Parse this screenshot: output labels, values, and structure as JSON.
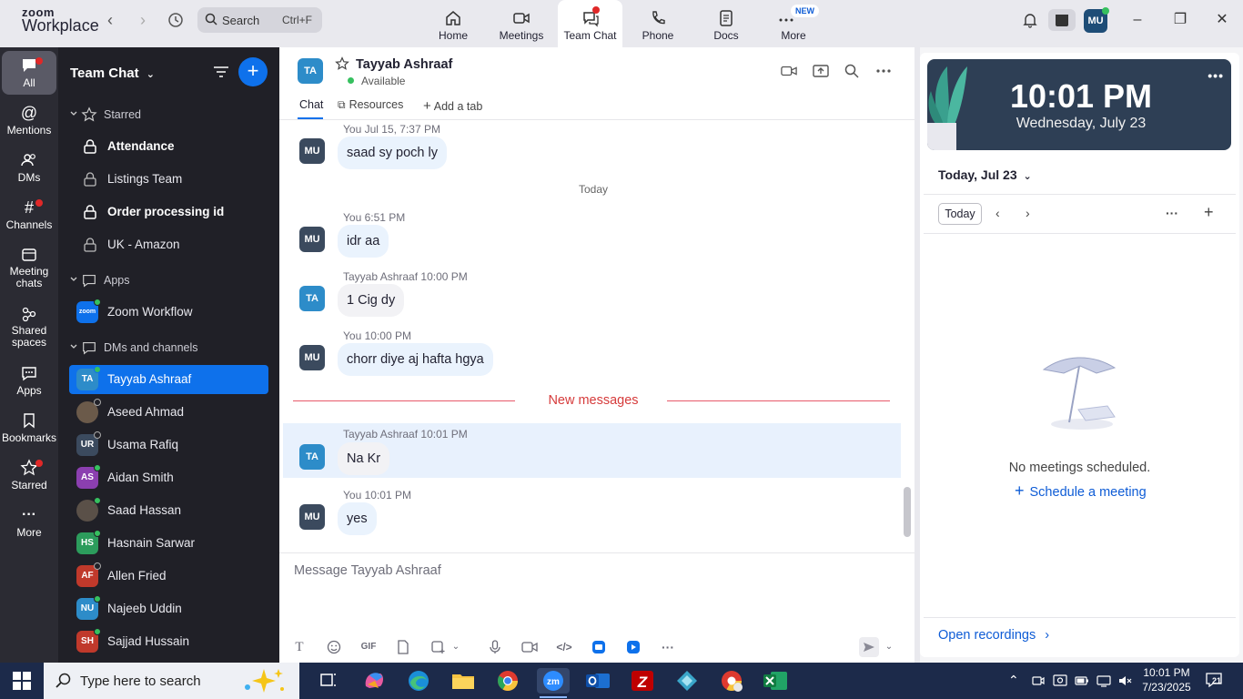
{
  "app": {
    "logo_line1": "zoom",
    "logo_line2": "Workplace"
  },
  "topbar": {
    "search_label": "Search",
    "search_shortcut": "Ctrl+F",
    "nav": [
      {
        "label": "Home"
      },
      {
        "label": "Meetings"
      },
      {
        "label": "Team Chat"
      },
      {
        "label": "Phone"
      },
      {
        "label": "Docs"
      },
      {
        "label": "More",
        "badge": "NEW"
      }
    ],
    "avatar_initials": "MU"
  },
  "rail": [
    {
      "label": "All"
    },
    {
      "label": "Mentions"
    },
    {
      "label": "DMs"
    },
    {
      "label": "Channels"
    },
    {
      "label": "Meeting\nchats"
    },
    {
      "label": "Shared\nspaces"
    },
    {
      "label": "Apps"
    },
    {
      "label": "Bookmarks"
    },
    {
      "label": "Starred"
    },
    {
      "label": "More"
    }
  ],
  "sidebar": {
    "title": "Team Chat",
    "starred_label": "Starred",
    "starred": [
      {
        "label": "Attendance"
      },
      {
        "label": "Listings Team"
      },
      {
        "label": "Order processing id"
      },
      {
        "label": "UK - Amazon"
      }
    ],
    "apps_label": "Apps",
    "apps": [
      {
        "label": "Zoom Workflow",
        "icon_text": "zoom"
      }
    ],
    "dms_label": "DMs and channels",
    "dms": [
      {
        "label": "Tayyab Ashraaf",
        "initials": "TA",
        "color": "#2d8cc9"
      },
      {
        "label": "Aseed Ahmad",
        "initials": "",
        "color": "#6b5a4a"
      },
      {
        "label": "Usama Rafiq",
        "initials": "UR",
        "color": "#3b4a5e"
      },
      {
        "label": "Aidan Smith",
        "initials": "AS",
        "color": "#8b3fb0"
      },
      {
        "label": "Saad Hassan",
        "initials": "",
        "color": "#5a5048"
      },
      {
        "label": "Hasnain Sarwar",
        "initials": "HS",
        "color": "#2c9c5c"
      },
      {
        "label": "Allen Fried",
        "initials": "AF",
        "color": "#c0392b"
      },
      {
        "label": "Najeeb Uddin",
        "initials": "NU",
        "color": "#2d8cc9"
      },
      {
        "label": "Sajjad Hussain",
        "initials": "SH",
        "color": "#c0392b"
      }
    ]
  },
  "chat": {
    "header": {
      "initials": "TA",
      "name": "Tayyab Ashraaf",
      "status": "Available",
      "tabs": [
        "Chat",
        "Resources",
        "Add a tab"
      ]
    },
    "messages": [
      {
        "sender": "You",
        "time": "Jul 15, 7:37 PM",
        "text": "saad sy poch ly",
        "initials": "MU"
      },
      {
        "sender": "You",
        "time": "6:51 PM",
        "text": "idr aa",
        "initials": "MU"
      },
      {
        "sender": "Tayyab Ashraaf",
        "time": "10:00 PM",
        "text": "1 Cig dy",
        "initials": "TA"
      },
      {
        "sender": "You",
        "time": "10:00 PM",
        "text": "chorr diye aj hafta hgya",
        "initials": "MU"
      },
      {
        "sender": "Tayyab Ashraaf",
        "time": "10:01 PM",
        "text": "Na Kr",
        "initials": "TA"
      },
      {
        "sender": "You",
        "time": "10:01 PM",
        "text": "yes",
        "initials": "MU"
      }
    ],
    "date_separator": "Today",
    "new_messages_label": "New messages",
    "composer_placeholder": "Message Tayyab Ashraaf",
    "gif_label": "GIF"
  },
  "calendar": {
    "clock_time": "10:01 PM",
    "clock_date": "Wednesday, July 23",
    "header": "Today, Jul 23",
    "today_button": "Today",
    "empty_text": "No meetings scheduled.",
    "schedule_link": "Schedule a meeting",
    "open_recordings": "Open recordings"
  },
  "taskbar": {
    "search_placeholder": "Type here to search",
    "clock_time": "10:01 PM",
    "clock_date": "7/23/2025",
    "notif_count": "21"
  },
  "colors": {
    "accent": "#0e71eb",
    "sidebar_bg": "#202027",
    "rail_bg": "#2b2b33",
    "new_messages": "#d63b3b"
  }
}
